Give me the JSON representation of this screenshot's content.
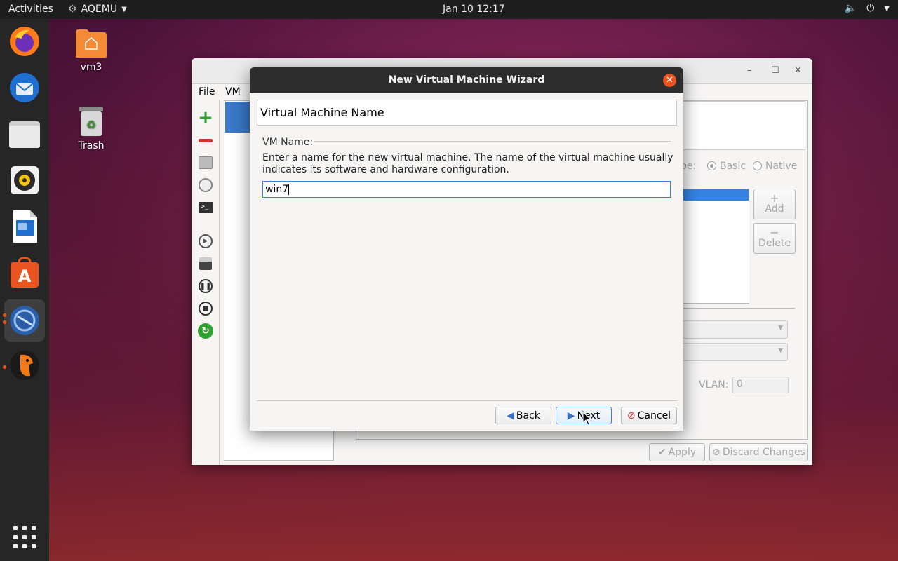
{
  "topbar": {
    "activities": "Activities",
    "app_name": "AQEMU",
    "clock": "Jan 10  12:17"
  },
  "desktop": {
    "icons": [
      {
        "label": "vm3"
      },
      {
        "label": "Trash"
      }
    ]
  },
  "dock": {
    "apps": [
      "firefox-icon",
      "thunderbird-icon",
      "files-icon",
      "rhythmbox-icon",
      "writer-icon",
      "software-icon",
      "aqemu-icon",
      "qemu-icon"
    ],
    "show_apps": "show-apps-icon"
  },
  "main_window": {
    "menu": {
      "file": "File",
      "vm": "VM"
    },
    "mode_label": "pe:",
    "mode_options": [
      "Basic",
      "Native"
    ],
    "add_label": "Add",
    "delete_label": "Delete",
    "vlan_label": "VLAN:",
    "vlan_value": "0",
    "apply_label": "Apply",
    "discard_label": "Discard Changes"
  },
  "dialog": {
    "title": "New Virtual Machine Wizard",
    "page_title": "Virtual Machine Name",
    "group_label": "VM Name:",
    "description": "Enter a name for the new virtual machine. The name of the virtual machine usually indicates its software and hardware configuration.",
    "name_value": "win7",
    "back_label": "Back",
    "next_label": "Next",
    "cancel_label": "Cancel"
  },
  "colors": {
    "accent": "#e95420",
    "focus": "#3584e4",
    "selection": "#3584e4"
  }
}
